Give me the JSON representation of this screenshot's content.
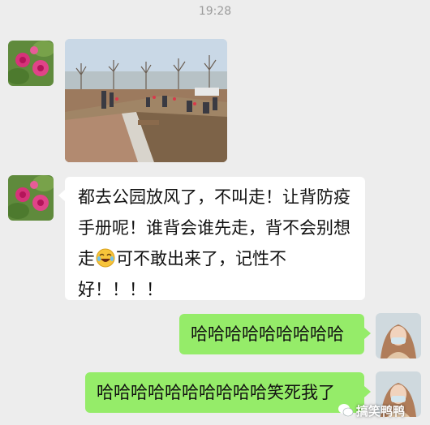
{
  "chat": {
    "timestamp": "19:28",
    "messages": [
      {
        "side": "left",
        "type": "image",
        "icon": "park-photo"
      },
      {
        "side": "left",
        "type": "text",
        "text_before_emoji": "都去公园放风了，不叫走！让背防疫手册呢！谁背会谁先走，背不会别想走",
        "emoji": "crying-laughing-emoji",
        "text_after_emoji": "可不敢出来了，记性不好！！！！"
      },
      {
        "side": "right",
        "type": "text",
        "text": "哈哈哈哈哈哈哈哈哈"
      },
      {
        "side": "right",
        "type": "text",
        "text": "哈哈哈哈哈哈哈哈哈哈笑死我了"
      }
    ]
  },
  "watermark": {
    "text": "搞笑鸭鸭",
    "icon": "wechat-icon"
  },
  "colors": {
    "background": "#ededed",
    "received_bubble": "#ffffff",
    "sent_bubble": "#95ec69",
    "timestamp": "#9b9b9b"
  }
}
